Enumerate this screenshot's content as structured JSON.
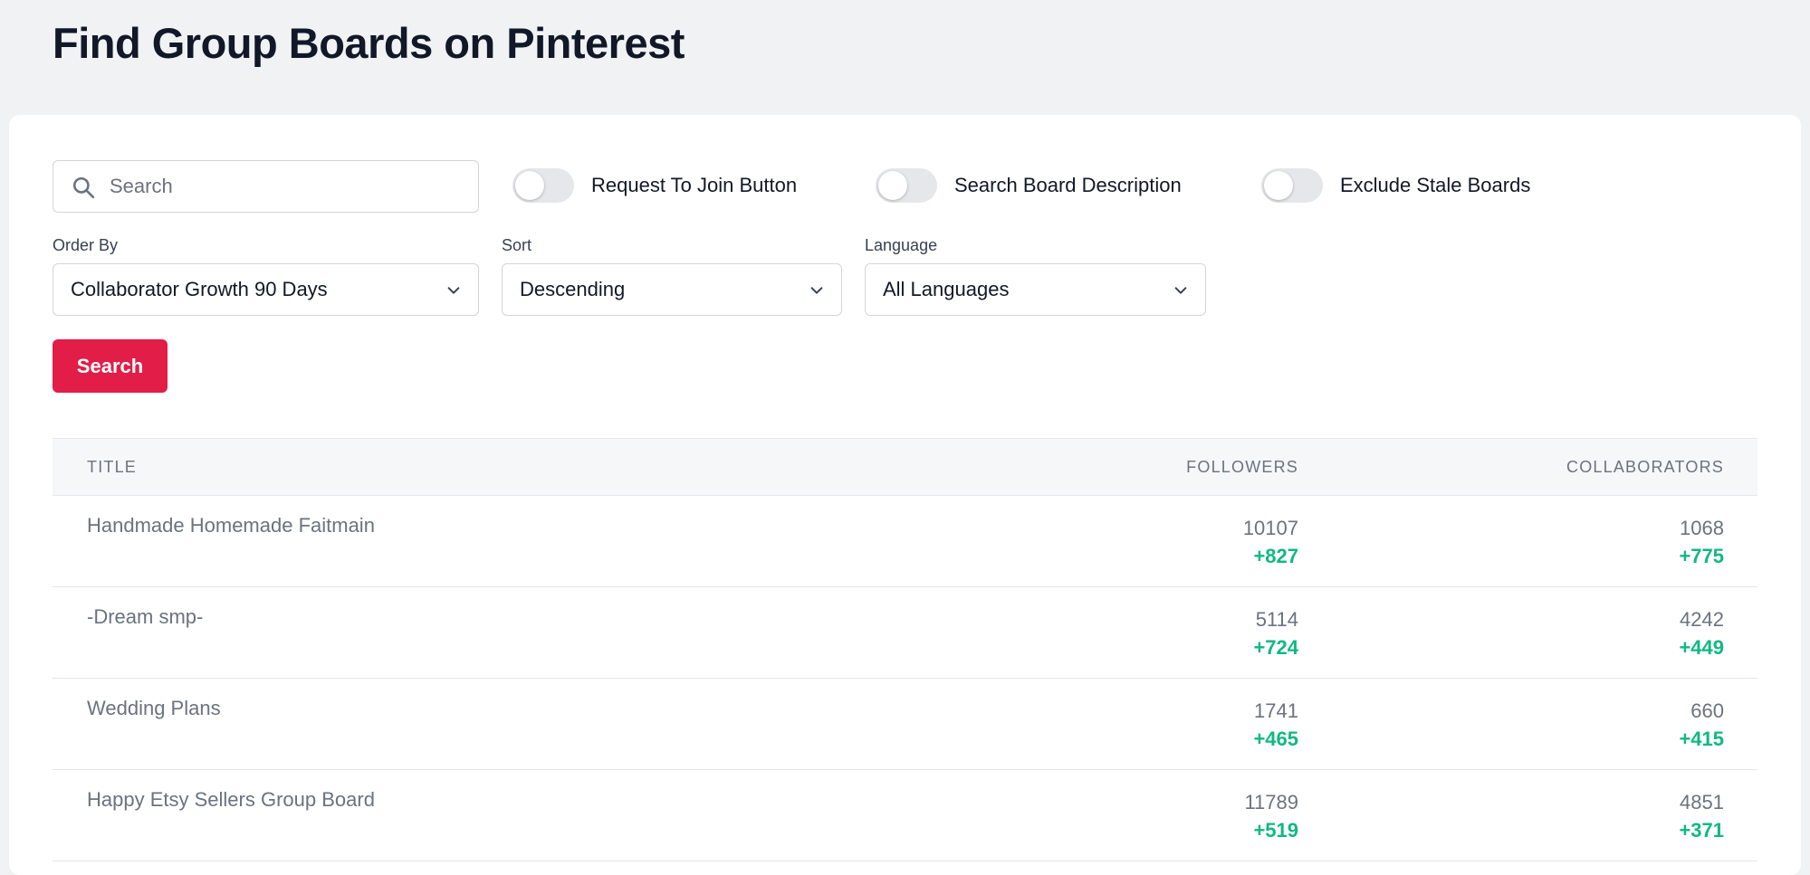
{
  "page": {
    "title": "Find Group Boards on Pinterest"
  },
  "filters": {
    "search_placeholder": "Search",
    "toggles": [
      {
        "label": "Request To Join Button",
        "on": false
      },
      {
        "label": "Search Board Description",
        "on": false
      },
      {
        "label": "Exclude Stale Boards",
        "on": false
      }
    ],
    "order_by": {
      "label": "Order By",
      "value": "Collaborator Growth 90 Days"
    },
    "sort": {
      "label": "Sort",
      "value": "Descending"
    },
    "language": {
      "label": "Language",
      "value": "All Languages"
    },
    "search_button": "Search"
  },
  "table": {
    "columns": [
      "TITLE",
      "FOLLOWERS",
      "COLLABORATORS"
    ],
    "rows": [
      {
        "title": "Handmade Homemade Faitmain",
        "followers": "10107",
        "followers_delta": "+827",
        "collaborators": "1068",
        "collaborators_delta": "+775"
      },
      {
        "title": "-Dream smp-",
        "followers": "5114",
        "followers_delta": "+724",
        "collaborators": "4242",
        "collaborators_delta": "+449"
      },
      {
        "title": "Wedding Plans",
        "followers": "1741",
        "followers_delta": "+465",
        "collaborators": "660",
        "collaborators_delta": "+415"
      },
      {
        "title": "Happy Etsy Sellers Group Board",
        "followers": "11789",
        "followers_delta": "+519",
        "collaborators": "4851",
        "collaborators_delta": "+371"
      }
    ]
  },
  "colors": {
    "accent": "#e11d48",
    "positive": "#10b981",
    "background": "#f0f2f4"
  }
}
